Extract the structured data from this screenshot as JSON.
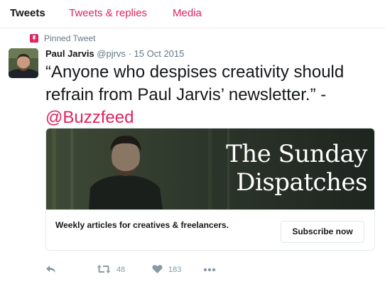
{
  "tabs": [
    {
      "label": "Tweets"
    },
    {
      "label": "Tweets & replies"
    },
    {
      "label": "Media"
    }
  ],
  "tweet": {
    "pinned_label": "Pinned Tweet",
    "author_name": "Paul Jarvis",
    "handle": "@pjrvs",
    "separator": "·",
    "date": "15 Oct 2015",
    "text": "“Anyone who despises creativity should refrain from Paul Jarvis’ newsletter.” -",
    "mention": "@Buzzfeed",
    "card": {
      "title_line1": "The Sunday",
      "title_line2": "Dispatches",
      "description": "Weekly articles for creatives & freelancers.",
      "button_label": "Subscribe now"
    },
    "actions": {
      "retweet_count": "48",
      "like_count": "183"
    }
  },
  "colors": {
    "accent": "#e0245e",
    "muted": "#657786",
    "icon": "#8899a6",
    "border": "#e1e8ed"
  },
  "icons": [
    "pin-icon",
    "reply-icon",
    "retweet-icon",
    "heart-icon",
    "more-icon"
  ]
}
